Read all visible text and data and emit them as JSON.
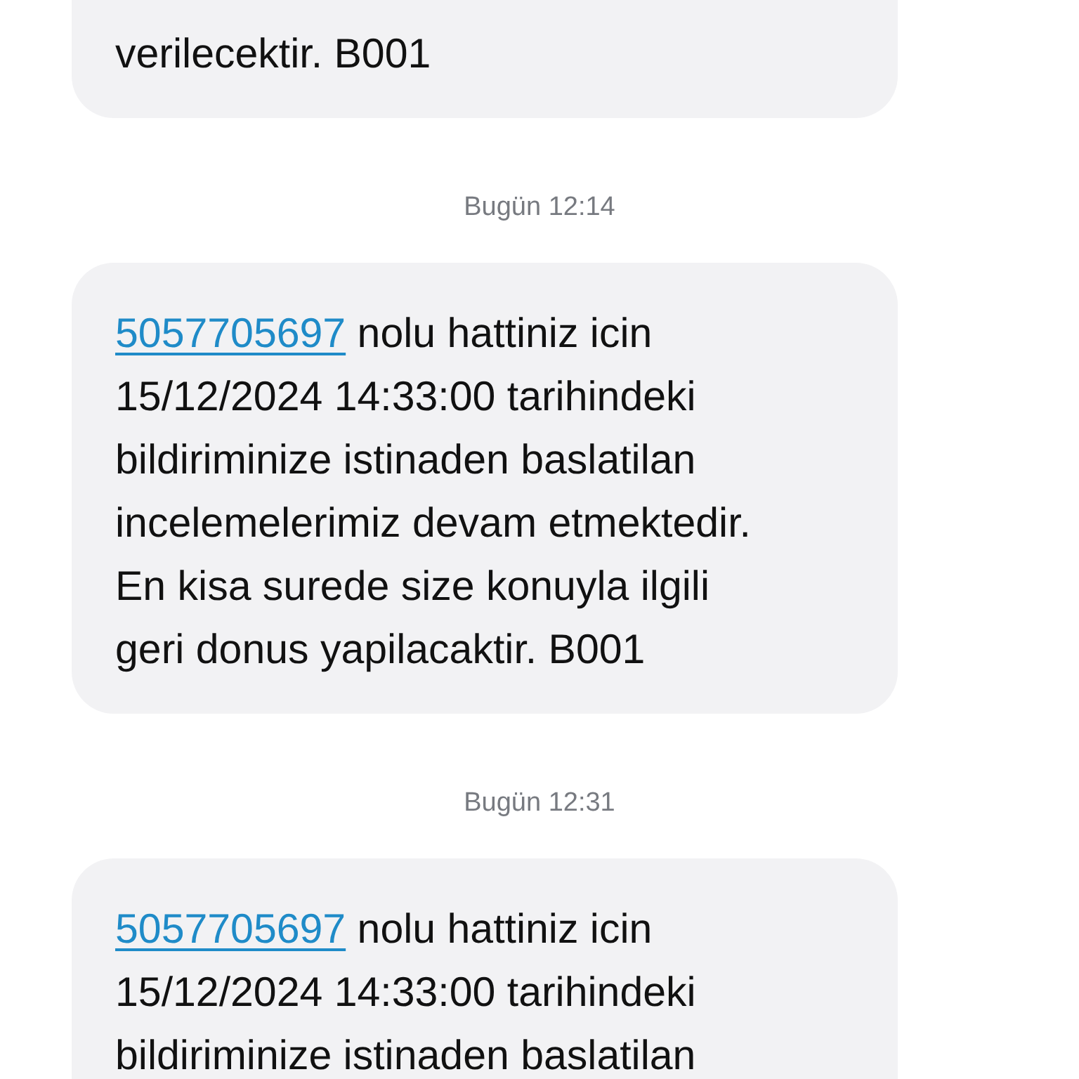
{
  "messages": [
    {
      "kind": "message",
      "lines": [
        "verilecektir. B001"
      ]
    },
    {
      "kind": "timestamp",
      "text": "Bugün 12:14"
    },
    {
      "kind": "message",
      "link": "5057705697",
      "lines": [
        "nolu hattiniz icin",
        "15/12/2024 14:33:00  tarihindeki",
        "bildiriminize istinaden baslatilan",
        "incelemelerimiz devam etmektedir.",
        "En kisa surede size konuyla ilgili",
        "geri donus yapilacaktir. B001"
      ]
    },
    {
      "kind": "timestamp",
      "text": "Bugün 12:31"
    },
    {
      "kind": "message",
      "link": "5057705697",
      "lines": [
        "nolu hattiniz icin",
        "15/12/2024 14:33:00  tarihindeki",
        "bildiriminize istinaden baslatilan"
      ]
    }
  ]
}
